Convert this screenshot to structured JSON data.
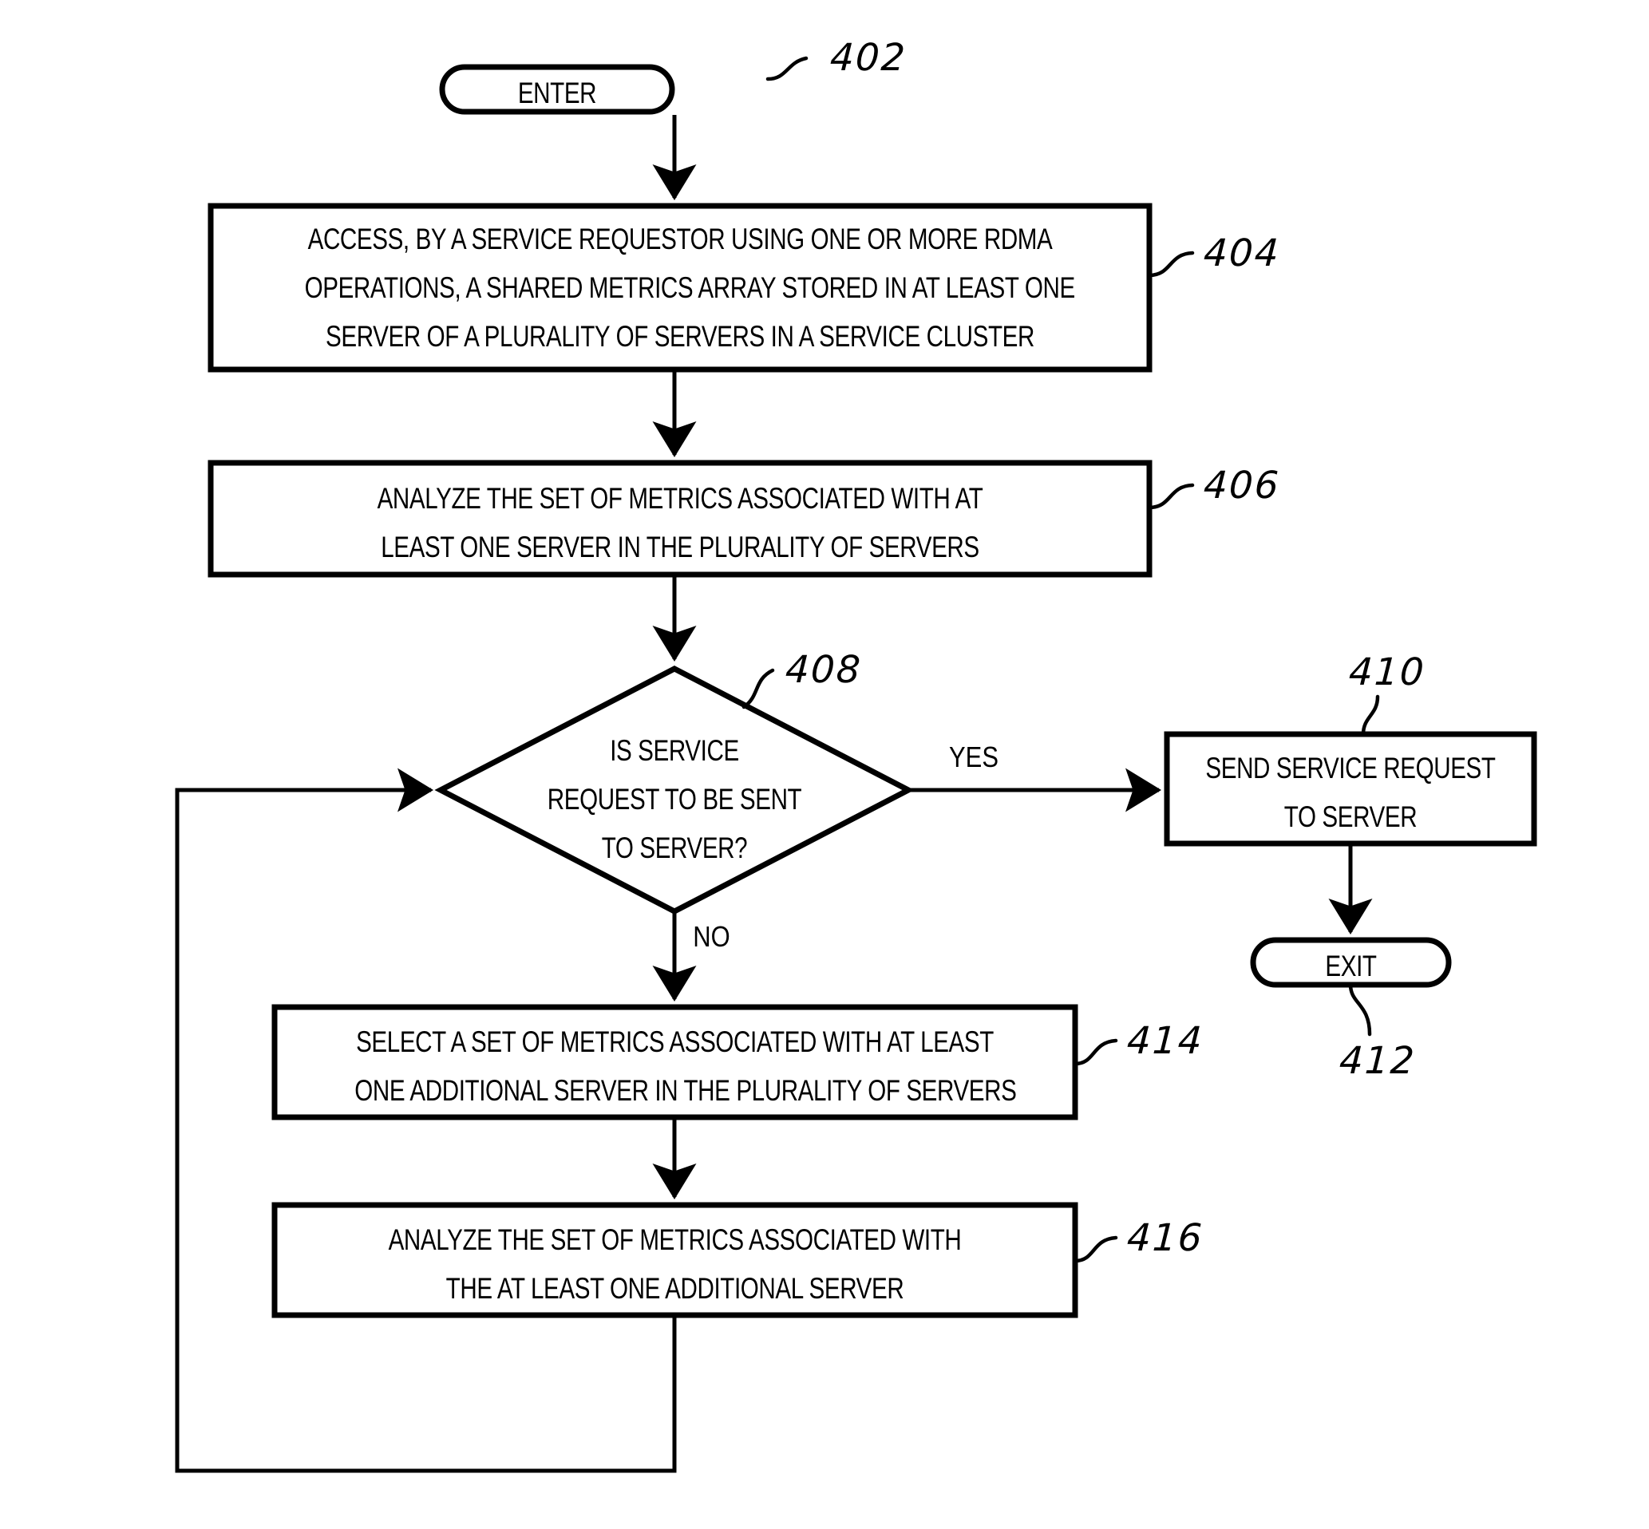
{
  "figure": {
    "type": "patent-flowchart",
    "background_color": "#ffffff",
    "stroke_color": "#000000"
  },
  "nodes": {
    "enter": {
      "label": "ENTER",
      "ref": "402",
      "shape": "terminal"
    },
    "access": {
      "lines": [
        "ACCESS, BY A SERVICE REQUESTOR USING ONE OR MORE RDMA",
        "OPERATIONS, A SHARED METRICS ARRAY STORED IN AT LEAST ONE",
        "SERVER OF A PLURALITY OF SERVERS IN A SERVICE CLUSTER"
      ],
      "ref": "404",
      "shape": "process"
    },
    "analyze_first": {
      "lines": [
        "ANALYZE THE SET OF METRICS ASSOCIATED WITH AT",
        "LEAST ONE SERVER IN THE PLURALITY OF SERVERS"
      ],
      "ref": "406",
      "shape": "process"
    },
    "decision": {
      "lines": [
        "IS SERVICE",
        "REQUEST TO BE SENT",
        "TO SERVER?"
      ],
      "ref": "408",
      "shape": "decision"
    },
    "send_request": {
      "lines": [
        "SEND SERVICE REQUEST",
        "TO SERVER"
      ],
      "ref": "410",
      "shape": "process"
    },
    "exit": {
      "label": "EXIT",
      "ref": "412",
      "shape": "terminal"
    },
    "select_metrics": {
      "lines": [
        "SELECT A SET OF METRICS ASSOCIATED WITH AT LEAST",
        "ONE ADDITIONAL SERVER IN THE PLURALITY OF SERVERS"
      ],
      "ref": "414",
      "shape": "process"
    },
    "analyze_additional": {
      "lines": [
        "ANALYZE THE SET OF METRICS ASSOCIATED WITH",
        "THE AT LEAST ONE ADDITIONAL SERVER"
      ],
      "ref": "416",
      "shape": "process"
    }
  },
  "branches": {
    "yes": "YES",
    "no": "NO"
  }
}
